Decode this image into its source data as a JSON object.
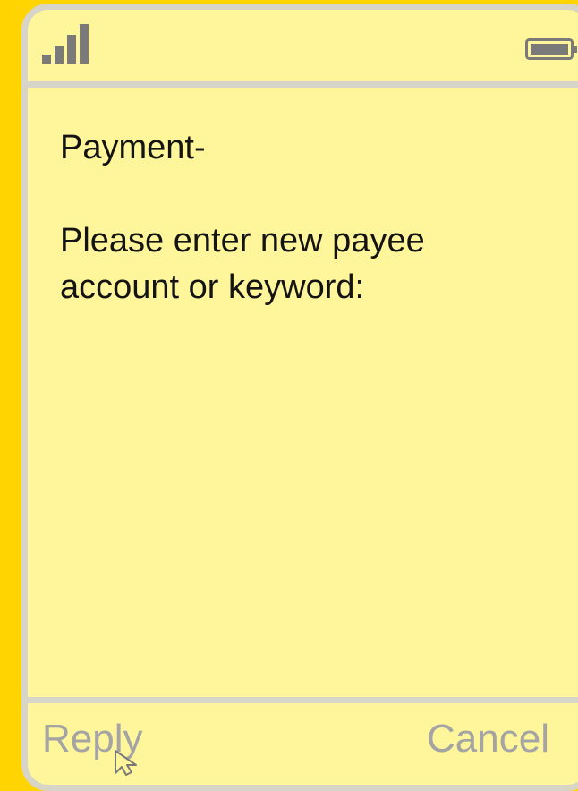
{
  "status_bar": {
    "signal_icon": "signal-bars-icon",
    "battery_icon": "battery-full-icon",
    "icon_color": "#7A7A7A"
  },
  "message": {
    "title": "Payment-",
    "prompt_line1": "Please enter new payee",
    "prompt_line2": "account or keyword:"
  },
  "softkeys": {
    "left_label": "Reply",
    "right_label": "Cancel"
  },
  "colors": {
    "background": "#FFD400",
    "screen": "#FFF59A",
    "frame": "#D7D4C8",
    "message_text": "#141414",
    "softkey_text": "#A4A4A4"
  }
}
